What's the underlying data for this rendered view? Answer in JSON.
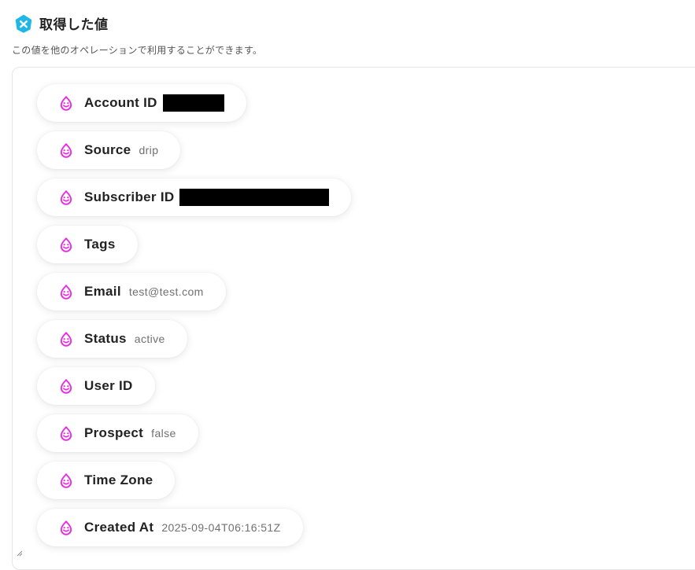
{
  "header": {
    "title": "取得した値",
    "icon": "yoom-hexagon-icon",
    "icon_color": "#1fb6e8"
  },
  "subtitle": "この値を他のオペレーションで利用することができます。",
  "chip_icon": "drip-icon",
  "chip_icon_color": "#ea2be0",
  "items": [
    {
      "label": "Account ID",
      "value": "",
      "redacted": true
    },
    {
      "label": "Source",
      "value": "drip",
      "redacted": false
    },
    {
      "label": "Subscriber ID",
      "value": "",
      "redacted": true
    },
    {
      "label": "Tags",
      "value": "",
      "redacted": false
    },
    {
      "label": "Email",
      "value": "test@test.com",
      "redacted": false
    },
    {
      "label": "Status",
      "value": "active",
      "redacted": false
    },
    {
      "label": "User ID",
      "value": "",
      "redacted": false
    },
    {
      "label": "Prospect",
      "value": "false",
      "redacted": false
    },
    {
      "label": "Time Zone",
      "value": "",
      "redacted": false
    },
    {
      "label": "Created At",
      "value": "2025-09-04T06:16:51Z",
      "redacted": false
    }
  ]
}
